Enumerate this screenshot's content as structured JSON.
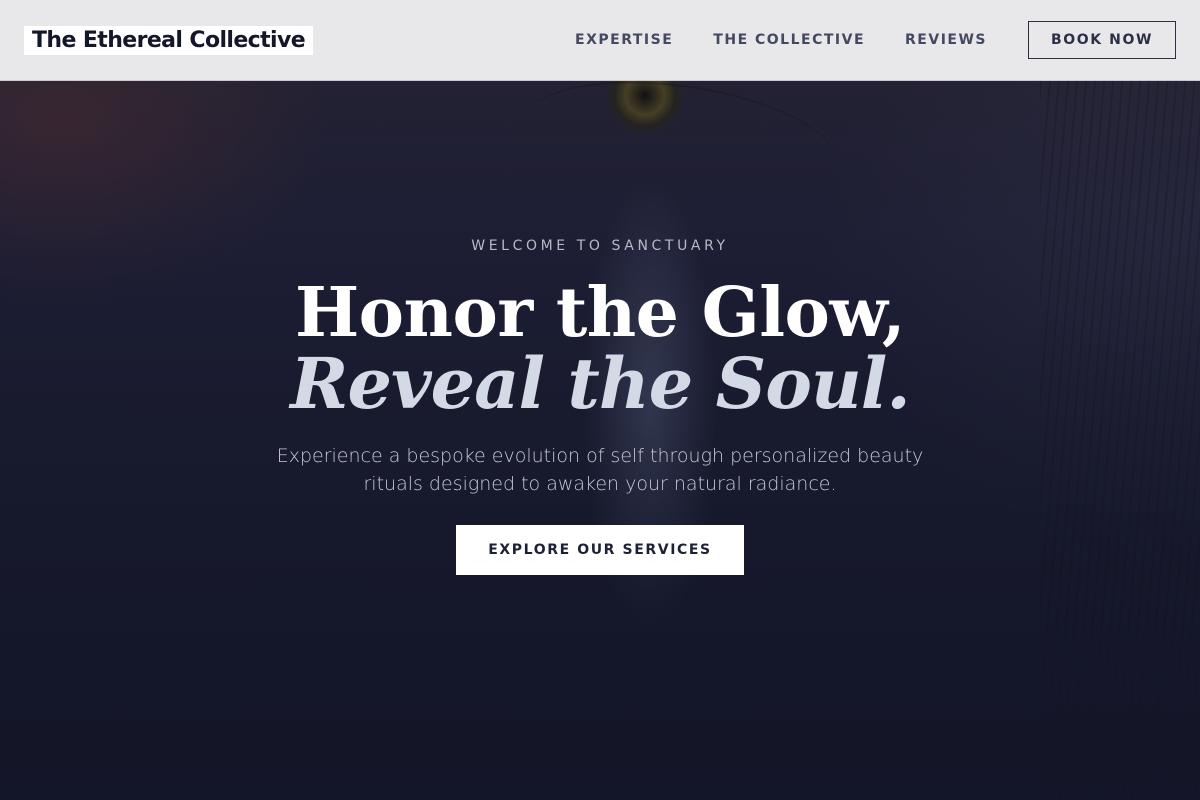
{
  "brand": {
    "name": "The Ethereal Collective"
  },
  "nav": {
    "items": [
      {
        "label": "EXPERTISE"
      },
      {
        "label": "THE COLLECTIVE"
      },
      {
        "label": "REVIEWS"
      }
    ],
    "book_label": "BOOK NOW"
  },
  "hero": {
    "eyebrow": "WELCOME TO SANCTUARY",
    "headline_line1": "Honor the Glow,",
    "headline_line2": "Reveal the Soul.",
    "subtext": "Experience a bespoke evolution of self through personalized beauty rituals designed to awaken your natural radiance.",
    "cta_label": "EXPLORE OUR SERVICES"
  },
  "colors": {
    "header_bg": "#e8e8ea",
    "hero_bg": "#1b1d32",
    "accent_text": "#14172a",
    "cta_bg": "#ffffff"
  }
}
